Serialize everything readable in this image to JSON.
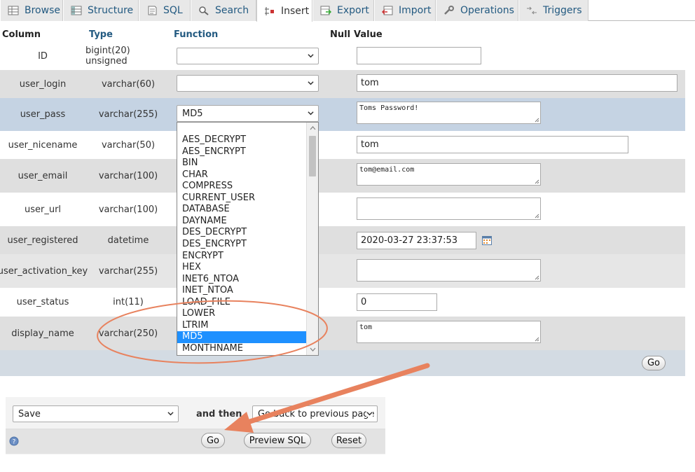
{
  "tabs": [
    {
      "label": "Browse",
      "icon": "browse-icon"
    },
    {
      "label": "Structure",
      "icon": "structure-icon"
    },
    {
      "label": "SQL",
      "icon": "sql-icon"
    },
    {
      "label": "Search",
      "icon": "search-icon"
    },
    {
      "label": "Insert",
      "icon": "insert-icon",
      "active": true
    },
    {
      "label": "Export",
      "icon": "export-icon"
    },
    {
      "label": "Import",
      "icon": "import-icon"
    },
    {
      "label": "Operations",
      "icon": "wrench-icon"
    },
    {
      "label": "Triggers",
      "icon": "triggers-icon"
    }
  ],
  "headers": {
    "column": "Column",
    "type": "Type",
    "function": "Function",
    "null": "Null",
    "value": "Value"
  },
  "rows": [
    {
      "column": "ID",
      "type": "bigint(20) unsigned",
      "function": "",
      "value": "",
      "value_kind": "input"
    },
    {
      "column": "user_login",
      "type": "varchar(60)",
      "function": "",
      "value": "tom",
      "value_kind": "input"
    },
    {
      "column": "user_pass",
      "type": "varchar(255)",
      "function": "MD5",
      "value": "Toms Password!",
      "value_kind": "textarea"
    },
    {
      "column": "user_nicename",
      "type": "varchar(50)",
      "function": "",
      "value": "tom",
      "value_kind": "input"
    },
    {
      "column": "user_email",
      "type": "varchar(100)",
      "function": "",
      "value": "tom@email.com",
      "value_kind": "textarea"
    },
    {
      "column": "user_url",
      "type": "varchar(100)",
      "function": "",
      "value": "",
      "value_kind": "textarea"
    },
    {
      "column": "user_registered",
      "type": "datetime",
      "function": "",
      "value": "2020-03-27 23:37:53",
      "value_kind": "input"
    },
    {
      "column": "user_activation_key",
      "type": "varchar(255)",
      "function": "",
      "value": "",
      "value_kind": "textarea"
    },
    {
      "column": "user_status",
      "type": "int(11)",
      "function": "",
      "value": "0",
      "value_kind": "input"
    },
    {
      "column": "display_name",
      "type": "varchar(250)",
      "function": "",
      "value": "tom",
      "value_kind": "textarea"
    }
  ],
  "function_options": [
    "AES_DECRYPT",
    "AES_ENCRYPT",
    "BIN",
    "CHAR",
    "COMPRESS",
    "CURRENT_USER",
    "DATABASE",
    "DAYNAME",
    "DES_DECRYPT",
    "DES_ENCRYPT",
    "ENCRYPT",
    "HEX",
    "INET6_NTOA",
    "INET_NTOA",
    "LOAD_FILE",
    "LOWER",
    "LTRIM",
    "MD5",
    "MONTHNAME"
  ],
  "function_selected": "MD5",
  "go_label": "Go",
  "bottom": {
    "action_select": "Save",
    "and_then_label": "and then",
    "after_select": "Go back to previous page",
    "go_label": "Go",
    "preview_label": "Preview SQL",
    "reset_label": "Reset"
  },
  "colors": {
    "link": "#235a81",
    "row_alt": "#dfdfdf",
    "row_marked": "#c5d3e3",
    "highlight": "#1e90ff",
    "annotation": "#e8825e"
  }
}
